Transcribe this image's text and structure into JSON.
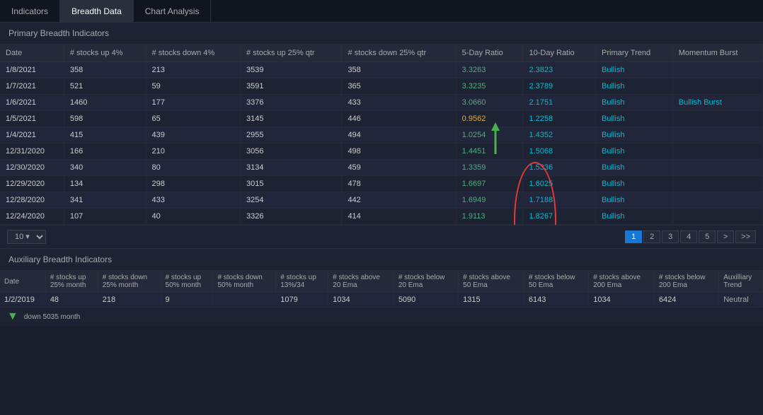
{
  "nav": {
    "tabs": [
      {
        "label": "Indicators",
        "active": false
      },
      {
        "label": "Breadth Data",
        "active": true
      },
      {
        "label": "Chart Analysis",
        "active": false
      }
    ]
  },
  "primary": {
    "section_title": "Primary Breadth Indicators",
    "columns": [
      "Date",
      "# stocks up 4%",
      "# stocks down 4%",
      "# stocks up 25% qtr",
      "# stocks down 25% qtr",
      "5-Day Ratio",
      "10-Day Ratio",
      "Primary Trend",
      "Momentum Burst"
    ],
    "rows": [
      {
        "date": "1/8/2021",
        "up4": "358",
        "dn4": "213",
        "up25q": "3539",
        "dn25q": "358",
        "ratio5": "3.3263",
        "ratio5_color": "green",
        "ratio10": "2.3823",
        "trend": "Bullish",
        "burst": "",
        "arrow": true
      },
      {
        "date": "1/7/2021",
        "up4": "521",
        "dn4": "59",
        "up25q": "3591",
        "dn25q": "365",
        "ratio5": "3.3235",
        "ratio5_color": "green",
        "ratio10": "2.3789",
        "trend": "Bullish",
        "burst": ""
      },
      {
        "date": "1/6/2021",
        "up4": "1460",
        "dn4": "177",
        "up25q": "3376",
        "dn25q": "433",
        "ratio5": "3.0660",
        "ratio5_color": "green",
        "ratio10": "2.1751",
        "trend": "Bullish",
        "burst": "Bullish Burst"
      },
      {
        "date": "1/5/2021",
        "up4": "598",
        "dn4": "65",
        "up25q": "3145",
        "dn25q": "446",
        "ratio5": "0.9562",
        "ratio5_color": "yellow",
        "ratio10": "1.2258",
        "trend": "Bullish",
        "burst": "",
        "oval": true
      },
      {
        "date": "1/4/2021",
        "up4": "415",
        "dn4": "439",
        "up25q": "2955",
        "dn25q": "494",
        "ratio5": "1.0254",
        "ratio5_color": "green",
        "ratio10": "1.4352",
        "trend": "Bullish",
        "burst": "",
        "oval": true
      },
      {
        "date": "12/31/2020",
        "up4": "166",
        "dn4": "210",
        "up25q": "3056",
        "dn25q": "498",
        "ratio5": "1.4451",
        "ratio5_color": "green",
        "ratio10": "1.5068",
        "trend": "Bullish",
        "burst": "",
        "oval": true
      },
      {
        "date": "12/30/2020",
        "up4": "340",
        "dn4": "80",
        "up25q": "3134",
        "dn25q": "459",
        "ratio5": "1.3359",
        "ratio5_color": "green",
        "ratio10": "1.5336",
        "trend": "Bullish",
        "burst": "",
        "oval": true
      },
      {
        "date": "12/29/2020",
        "up4": "134",
        "dn4": "298",
        "up25q": "3015",
        "dn25q": "478",
        "ratio5": "1.6697",
        "ratio5_color": "green",
        "ratio10": "1.6025",
        "trend": "Bullish",
        "burst": "",
        "oval": true
      },
      {
        "date": "12/28/2020",
        "up4": "341",
        "dn4": "433",
        "up25q": "3254",
        "dn25q": "442",
        "ratio5": "1.6949",
        "ratio5_color": "green",
        "ratio10": "1.7188",
        "trend": "Bullish",
        "burst": "",
        "oval": true
      },
      {
        "date": "12/24/2020",
        "up4": "107",
        "dn4": "40",
        "up25q": "3326",
        "dn25q": "414",
        "ratio5": "1.9113",
        "ratio5_color": "green",
        "ratio10": "1.8267",
        "trend": "Bullish",
        "burst": ""
      }
    ],
    "pagination": {
      "page_size": "10",
      "pages": [
        "1",
        "2",
        "3",
        "4",
        "5"
      ],
      "active_page": "1",
      "next": ">",
      "last": ">>"
    }
  },
  "auxiliary": {
    "section_title": "Auxiliary Breadth Indicators",
    "columns": [
      "Date",
      "# stocks up 25% month",
      "# stocks down 25% month",
      "# stocks up 50% month",
      "# stocks down 50% month",
      "# stocks up 13%/34",
      "# stocks above 20 Ema",
      "# stocks below 20 Ema",
      "# stocks above 50 Ema",
      "# stocks below 50 Ema",
      "# stocks above 200 Ema",
      "# stocks below 200 Ema",
      "Auxilliary Trend"
    ],
    "rows": [
      {
        "date": "1/2/2019",
        "up25m": "48",
        "dn25m": "218",
        "up50m": "9",
        "dn50m": "",
        "up13": "1079",
        "above20": "1034",
        "below20": "5090",
        "above50": "1315",
        "below50": "6143",
        "above200": "1034",
        "below200": "6424",
        "trend": "Neutral"
      }
    ],
    "down_label": "down 5035 month"
  },
  "colors": {
    "green": "#4caf7d",
    "yellow": "#e0b040",
    "cyan": "#00bcd4",
    "red_oval": "#e53935",
    "green_arrow": "#4caf50",
    "active_page_bg": "#1976d2"
  }
}
